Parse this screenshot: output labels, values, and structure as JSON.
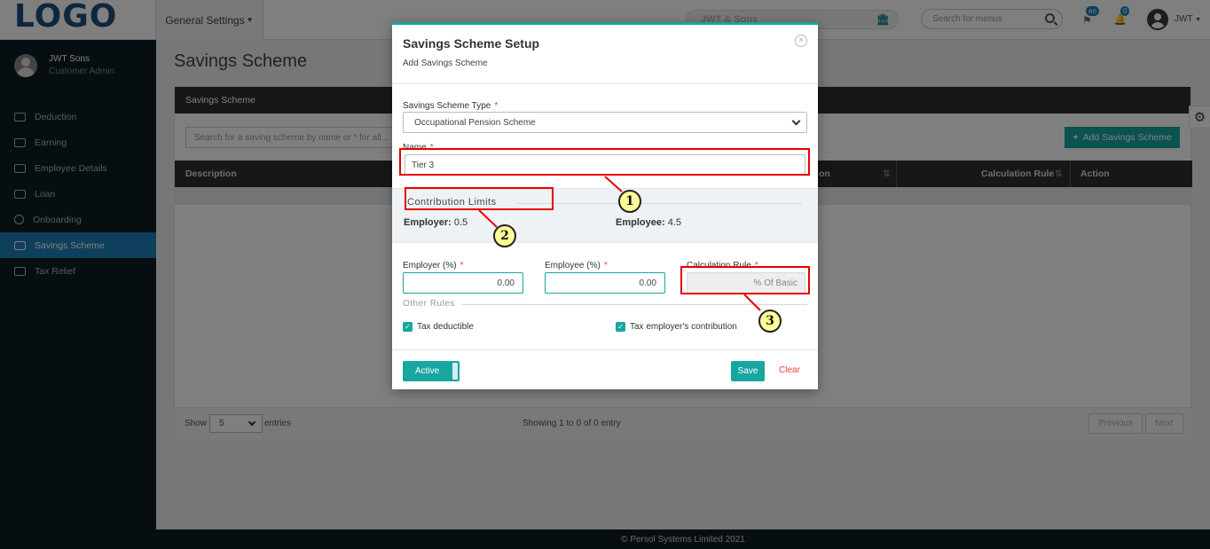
{
  "topbar": {
    "logo": "LOGO",
    "general_settings": "General Settings",
    "company": "JWT & Sons",
    "search_placeholder": "Search for menus",
    "lang_badge": "en",
    "notif_count": "0",
    "user": "JWT"
  },
  "sidebar": {
    "user_name": "JWT Sons",
    "user_role": "Customer Admin",
    "items": [
      {
        "label": "Deduction"
      },
      {
        "label": "Earning"
      },
      {
        "label": "Employee Details"
      },
      {
        "label": "Loan"
      },
      {
        "label": "Onboarding"
      },
      {
        "label": "Savings Scheme"
      },
      {
        "label": "Tax Relief"
      }
    ],
    "active_item": "Savings Scheme"
  },
  "main": {
    "title": "Savings Scheme",
    "card_title": "Savings Scheme",
    "search_placeholder": "Search for a saving scheme by name or * for all...",
    "add_button": "Add Savings Scheme",
    "columns": [
      "Description",
      "on",
      "Calculation Rule",
      "Action"
    ],
    "show_label": "Show",
    "show_value": "5",
    "entries_label": "entries",
    "showing": "Showing 1 to 0 of 0 entry",
    "prev": "Previous",
    "next": "Next"
  },
  "footer": "© Persol Systems Limited 2021",
  "modal": {
    "title": "Savings Scheme Setup",
    "subtitle": "Add Savings Scheme",
    "scheme_type_label": "Savings Scheme Type",
    "scheme_type_value": "Occupational Pension Scheme",
    "name_label": "Name",
    "name_value": "Tier 3",
    "limits_title": "Contribution Limits",
    "employer_limit_label": "Employer:",
    "employer_limit_value": "0.5",
    "employee_limit_label": "Employee:",
    "employee_limit_value": "4.5",
    "employer_pct_label": "Employer (%)",
    "employer_pct_value": "0.00",
    "employee_pct_label": "Employee (%)",
    "employee_pct_value": "0.00",
    "calc_rule_label": "Calculation Rule",
    "calc_rule_value": "% Of Basic",
    "other_rules_title": "Other Rules",
    "tax_deductible_label": "Tax deductible",
    "tax_deductible_checked": true,
    "tax_employer_label": "Tax employer's contribution",
    "tax_employer_checked": true,
    "active_label": "Active",
    "save_label": "Save",
    "clear_label": "Clear",
    "required_mark": "*"
  },
  "annotations": {
    "callouts": [
      "1",
      "2",
      "3"
    ],
    "highlight_color": "#e60000",
    "callout_fill": "#ffff99"
  },
  "colors": {
    "accent": "#17a6a0",
    "sidebar_bg": "#0f1c24",
    "sidebar_active": "#1d7eb8",
    "danger": "#e8423a"
  }
}
